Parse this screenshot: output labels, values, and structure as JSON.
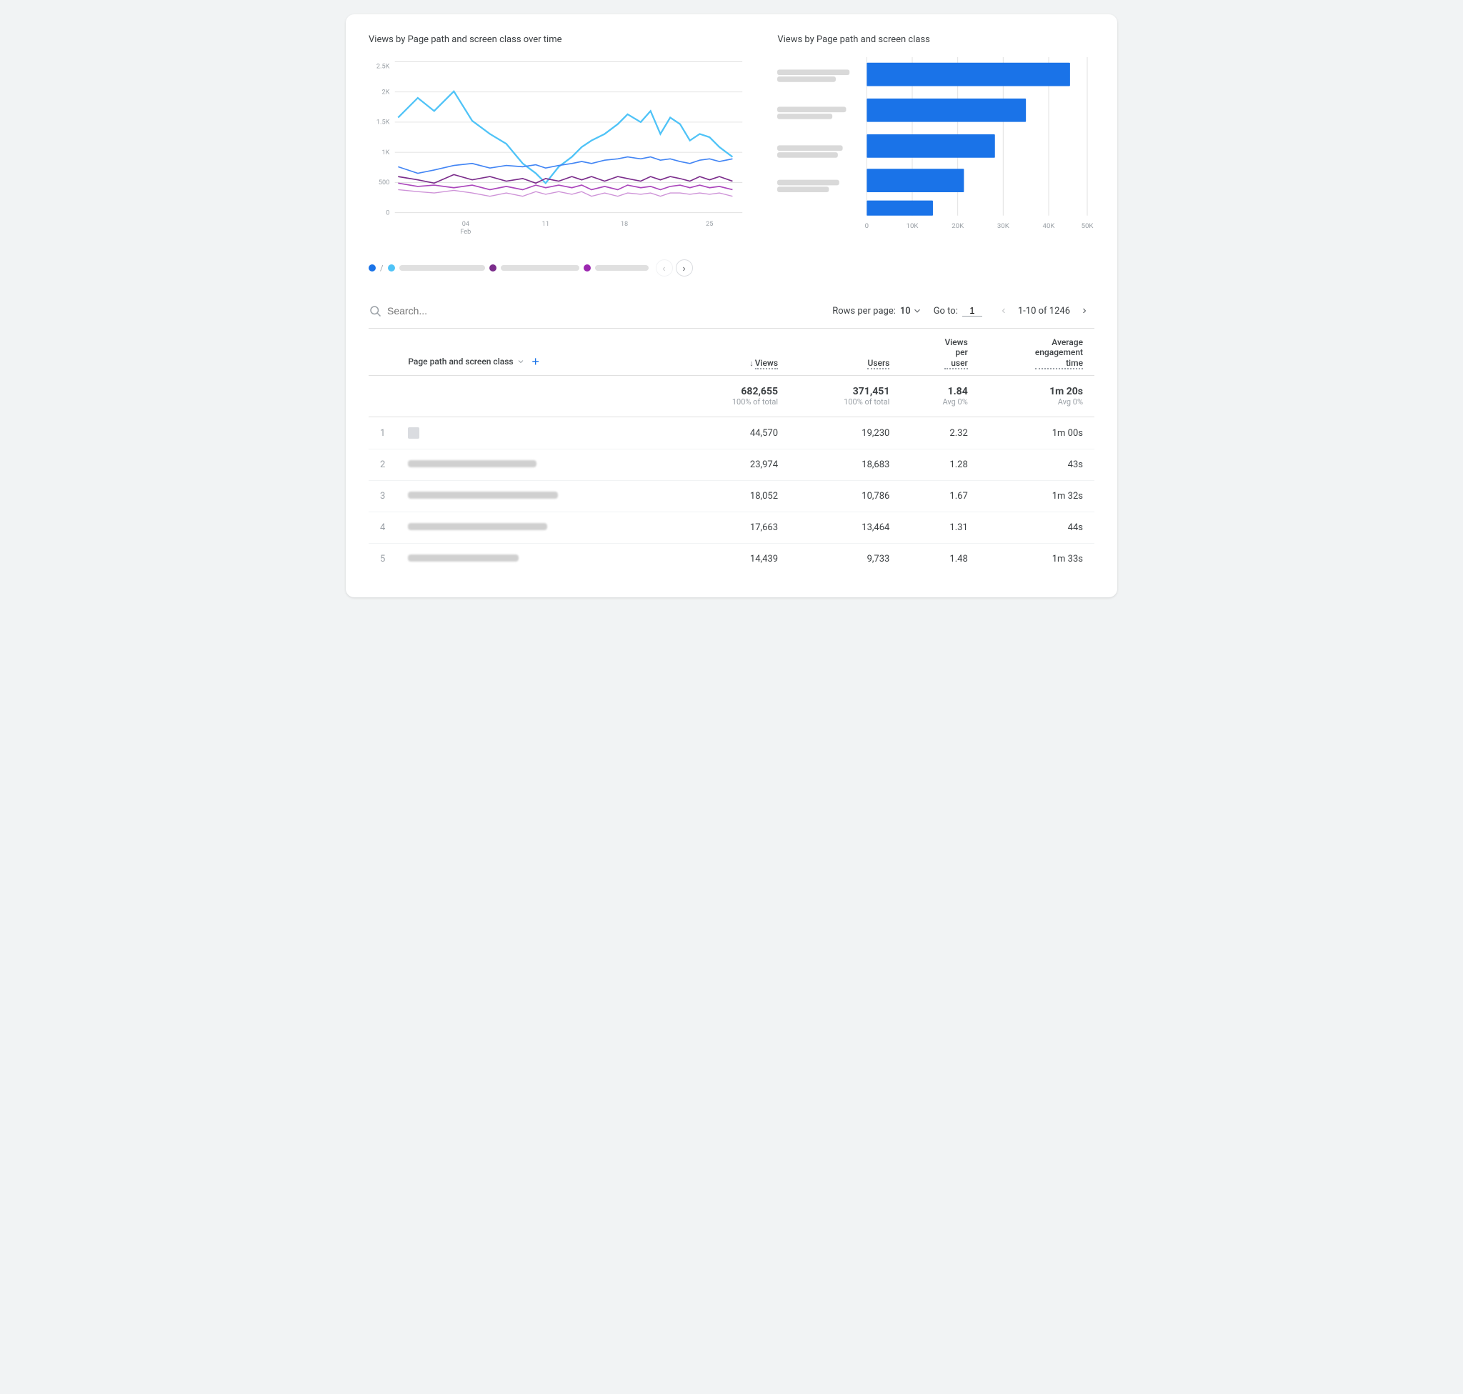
{
  "charts": {
    "left": {
      "title": "Views by Page path and screen class over time",
      "x_labels": [
        "04\nFeb",
        "11",
        "18",
        "25"
      ],
      "y_labels": [
        "0",
        "500",
        "1K",
        "1.5K",
        "2K",
        "2.5K"
      ]
    },
    "right": {
      "title": "Views by Page path and screen class",
      "x_labels": [
        "0",
        "10K",
        "20K",
        "30K",
        "40K",
        "50K"
      ],
      "bars": [
        {
          "width": 0.92,
          "value": "~46000"
        },
        {
          "width": 0.72,
          "value": "~36000"
        },
        {
          "width": 0.58,
          "value": "~29000"
        },
        {
          "width": 0.44,
          "value": "~22000"
        },
        {
          "width": 0.3,
          "value": "~15000"
        }
      ]
    }
  },
  "legend": {
    "items": [
      {
        "color": "#1a73e8",
        "label_width": "130px"
      },
      {
        "color": "#4285f4",
        "label_width": "110px"
      },
      {
        "color": "#7b2d8b",
        "label_width": "120px"
      },
      {
        "color": "#9c27b0",
        "label_width": "80px"
      }
    ],
    "sep": "/",
    "prev_disabled": true,
    "next_disabled": false
  },
  "table_controls": {
    "search_placeholder": "Search...",
    "rows_label": "Rows per page:",
    "rows_value": "10",
    "goto_label": "Go to:",
    "goto_value": "1",
    "pagination_text": "1-10 of 1246"
  },
  "table": {
    "columns": [
      {
        "label": "Page path and screen class",
        "key": "page",
        "align": "left",
        "sortable": true,
        "add": true
      },
      {
        "label": "Views",
        "key": "views",
        "align": "right",
        "sorted": true
      },
      {
        "label": "Users",
        "key": "users",
        "align": "right"
      },
      {
        "label": "Views per user",
        "key": "views_per_user",
        "align": "right"
      },
      {
        "label": "Average engagement time",
        "key": "avg_engagement",
        "align": "right"
      }
    ],
    "totals": {
      "views": "682,655",
      "views_sub": "100% of total",
      "users": "371,451",
      "users_sub": "100% of total",
      "views_per_user": "1.84",
      "views_per_user_sub": "Avg 0%",
      "avg_engagement": "1m 20s",
      "avg_engagement_sub": "Avg 0%"
    },
    "rows": [
      {
        "num": 1,
        "page": null,
        "page_icon": true,
        "views": "44,570",
        "users": "19,230",
        "vpu": "2.32",
        "avg": "1m 00s"
      },
      {
        "num": 2,
        "page": "blurred-long",
        "page_icon": false,
        "views": "23,974",
        "users": "18,683",
        "vpu": "1.28",
        "avg": "43s"
      },
      {
        "num": 3,
        "page": "blurred-medium",
        "page_icon": false,
        "views": "18,052",
        "users": "10,786",
        "vpu": "1.67",
        "avg": "1m 32s"
      },
      {
        "num": 4,
        "page": "blurred-medium2",
        "page_icon": false,
        "views": "17,663",
        "users": "13,464",
        "vpu": "1.31",
        "avg": "44s"
      },
      {
        "num": 5,
        "page": "blurred-short",
        "page_icon": false,
        "views": "14,439",
        "users": "9,733",
        "vpu": "1.48",
        "avg": "1m 33s"
      }
    ]
  },
  "colors": {
    "blue_primary": "#1a73e8",
    "blue_light": "#4fc3f7",
    "purple_dark": "#7b2d8b",
    "purple_light": "#ab47bc",
    "bar_color": "#1a73e8"
  }
}
